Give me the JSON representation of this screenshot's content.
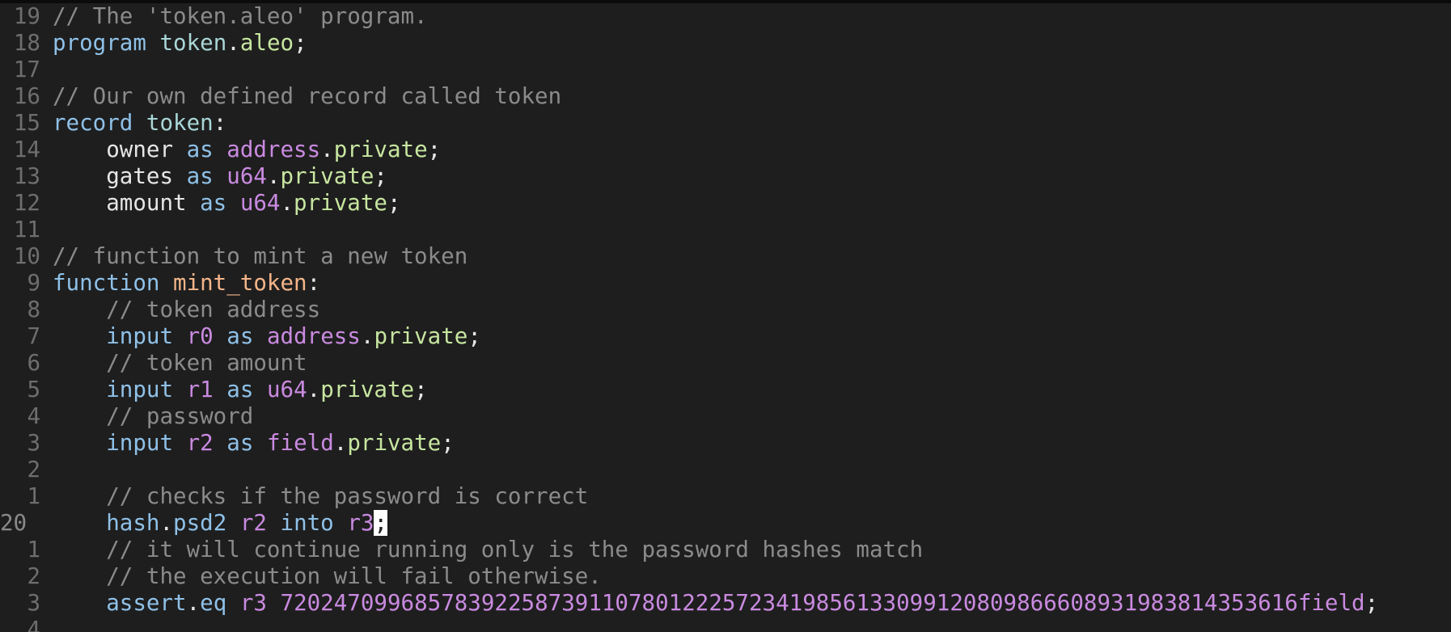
{
  "editor": {
    "lines": [
      {
        "num": "19",
        "current": false,
        "tokens": [
          {
            "t": "// The 'token.aleo' program.",
            "c": "comment"
          }
        ]
      },
      {
        "num": "18",
        "current": false,
        "tokens": [
          {
            "t": "program",
            "c": "kw"
          },
          {
            "t": " ",
            "c": "plain"
          },
          {
            "t": "token",
            "c": "name"
          },
          {
            "t": ".",
            "c": "plain"
          },
          {
            "t": "aleo",
            "c": "prop"
          },
          {
            "t": ";",
            "c": "plain"
          }
        ]
      },
      {
        "num": "17",
        "current": false,
        "tokens": []
      },
      {
        "num": "16",
        "current": false,
        "tokens": [
          {
            "t": "// Our own defined record called token",
            "c": "comment"
          }
        ]
      },
      {
        "num": "15",
        "current": false,
        "tokens": [
          {
            "t": "record",
            "c": "kw"
          },
          {
            "t": " ",
            "c": "plain"
          },
          {
            "t": "token",
            "c": "name"
          },
          {
            "t": ":",
            "c": "plain"
          }
        ]
      },
      {
        "num": "14",
        "current": false,
        "tokens": [
          {
            "t": "    owner ",
            "c": "plain"
          },
          {
            "t": "as",
            "c": "kw"
          },
          {
            "t": " ",
            "c": "plain"
          },
          {
            "t": "address",
            "c": "type"
          },
          {
            "t": ".",
            "c": "plain"
          },
          {
            "t": "private",
            "c": "prop"
          },
          {
            "t": ";",
            "c": "plain"
          }
        ]
      },
      {
        "num": "13",
        "current": false,
        "tokens": [
          {
            "t": "    gates ",
            "c": "plain"
          },
          {
            "t": "as",
            "c": "kw"
          },
          {
            "t": " ",
            "c": "plain"
          },
          {
            "t": "u64",
            "c": "type"
          },
          {
            "t": ".",
            "c": "plain"
          },
          {
            "t": "private",
            "c": "prop"
          },
          {
            "t": ";",
            "c": "plain"
          }
        ]
      },
      {
        "num": "12",
        "current": false,
        "tokens": [
          {
            "t": "    amount ",
            "c": "plain"
          },
          {
            "t": "as",
            "c": "kw"
          },
          {
            "t": " ",
            "c": "plain"
          },
          {
            "t": "u64",
            "c": "type"
          },
          {
            "t": ".",
            "c": "plain"
          },
          {
            "t": "private",
            "c": "prop"
          },
          {
            "t": ";",
            "c": "plain"
          }
        ]
      },
      {
        "num": "11",
        "current": false,
        "tokens": []
      },
      {
        "num": "10",
        "current": false,
        "tokens": [
          {
            "t": "// function to mint a new token",
            "c": "comment"
          }
        ]
      },
      {
        "num": "9",
        "current": false,
        "tokens": [
          {
            "t": "function",
            "c": "kw"
          },
          {
            "t": " ",
            "c": "plain"
          },
          {
            "t": "mint_token",
            "c": "func"
          },
          {
            "t": ":",
            "c": "plain"
          }
        ]
      },
      {
        "num": "8",
        "current": false,
        "tokens": [
          {
            "t": "    // token address",
            "c": "comment"
          }
        ]
      },
      {
        "num": "7",
        "current": false,
        "tokens": [
          {
            "t": "    ",
            "c": "plain"
          },
          {
            "t": "input",
            "c": "kw"
          },
          {
            "t": " ",
            "c": "plain"
          },
          {
            "t": "r0",
            "c": "reg"
          },
          {
            "t": " ",
            "c": "plain"
          },
          {
            "t": "as",
            "c": "kw"
          },
          {
            "t": " ",
            "c": "plain"
          },
          {
            "t": "address",
            "c": "type"
          },
          {
            "t": ".",
            "c": "plain"
          },
          {
            "t": "private",
            "c": "prop"
          },
          {
            "t": ";",
            "c": "plain"
          }
        ]
      },
      {
        "num": "6",
        "current": false,
        "tokens": [
          {
            "t": "    // token amount",
            "c": "comment"
          }
        ]
      },
      {
        "num": "5",
        "current": false,
        "tokens": [
          {
            "t": "    ",
            "c": "plain"
          },
          {
            "t": "input",
            "c": "kw"
          },
          {
            "t": " ",
            "c": "plain"
          },
          {
            "t": "r1",
            "c": "reg"
          },
          {
            "t": " ",
            "c": "plain"
          },
          {
            "t": "as",
            "c": "kw"
          },
          {
            "t": " ",
            "c": "plain"
          },
          {
            "t": "u64",
            "c": "type"
          },
          {
            "t": ".",
            "c": "plain"
          },
          {
            "t": "private",
            "c": "prop"
          },
          {
            "t": ";",
            "c": "plain"
          }
        ]
      },
      {
        "num": "4",
        "current": false,
        "tokens": [
          {
            "t": "    // password",
            "c": "comment"
          }
        ]
      },
      {
        "num": "3",
        "current": false,
        "tokens": [
          {
            "t": "    ",
            "c": "plain"
          },
          {
            "t": "input",
            "c": "kw"
          },
          {
            "t": " ",
            "c": "plain"
          },
          {
            "t": "r2",
            "c": "reg"
          },
          {
            "t": " ",
            "c": "plain"
          },
          {
            "t": "as",
            "c": "kw"
          },
          {
            "t": " ",
            "c": "plain"
          },
          {
            "t": "field",
            "c": "type"
          },
          {
            "t": ".",
            "c": "plain"
          },
          {
            "t": "private",
            "c": "prop"
          },
          {
            "t": ";",
            "c": "plain"
          }
        ]
      },
      {
        "num": "2",
        "current": false,
        "tokens": []
      },
      {
        "num": "1",
        "current": false,
        "tokens": [
          {
            "t": "    // checks if the password is correct",
            "c": "comment"
          }
        ]
      },
      {
        "num": "20",
        "current": true,
        "tokens": [
          {
            "t": "    ",
            "c": "plain"
          },
          {
            "t": "hash",
            "c": "kw"
          },
          {
            "t": ".",
            "c": "plain"
          },
          {
            "t": "psd2",
            "c": "kw"
          },
          {
            "t": " ",
            "c": "plain"
          },
          {
            "t": "r2",
            "c": "reg"
          },
          {
            "t": " ",
            "c": "plain"
          },
          {
            "t": "into",
            "c": "kw"
          },
          {
            "t": " ",
            "c": "plain"
          },
          {
            "t": "r3",
            "c": "reg"
          },
          {
            "t": ";",
            "c": "cursor"
          }
        ]
      },
      {
        "num": "1",
        "current": false,
        "tokens": [
          {
            "t": "    // it will continue running only is the password hashes match",
            "c": "comment"
          }
        ]
      },
      {
        "num": "2",
        "current": false,
        "tokens": [
          {
            "t": "    // the execution will fail otherwise.",
            "c": "comment"
          }
        ]
      },
      {
        "num": "3",
        "current": false,
        "tokens": [
          {
            "t": "    ",
            "c": "plain"
          },
          {
            "t": "assert",
            "c": "kw"
          },
          {
            "t": ".",
            "c": "plain"
          },
          {
            "t": "eq",
            "c": "kw"
          },
          {
            "t": " ",
            "c": "plain"
          },
          {
            "t": "r3",
            "c": "reg"
          },
          {
            "t": " ",
            "c": "plain"
          },
          {
            "t": "7202470996857839225873911078012225723419856133099120809866608931983814353616",
            "c": "num"
          },
          {
            "t": "field",
            "c": "field"
          },
          {
            "t": ";",
            "c": "plain"
          }
        ]
      },
      {
        "num": "4",
        "current": false,
        "tokens": []
      }
    ]
  }
}
